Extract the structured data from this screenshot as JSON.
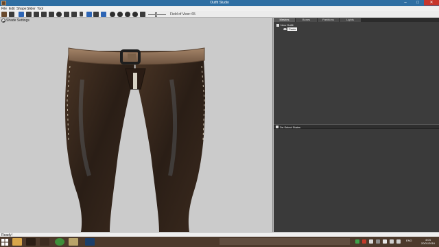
{
  "window": {
    "title": "Outfit Studio",
    "min_glyph": "–",
    "max_glyph": "□",
    "close_glyph": "✕"
  },
  "menu": [
    "File",
    "Edit",
    "Shape",
    "Slider",
    "Tool"
  ],
  "toolbar": {
    "fov_label": "Field of View: 65"
  },
  "viewport": {
    "shade_toggle_label": "Shade Settings"
  },
  "right_panel": {
    "tabs": [
      "Meshes",
      "Bones",
      "Partitions",
      "Lights"
    ],
    "active_tab": "Meshes",
    "tree": {
      "root_label": "New Outfit",
      "child_label": "Pants"
    },
    "deselect_label": "De-Select States"
  },
  "status": {
    "text": "Ready!"
  },
  "taskbar": {
    "tray_lang": "ENG",
    "clock_time": "4:04",
    "clock_date": "20/01/2016"
  },
  "colors": {
    "title_bar": "#2f6fa3",
    "panel_dark": "#3a3a3a",
    "viewport_bg": "#cbcbcb",
    "leather": "#3a2a1f",
    "belt": "#8a6c52",
    "taskbar": "#4d3a2c"
  }
}
